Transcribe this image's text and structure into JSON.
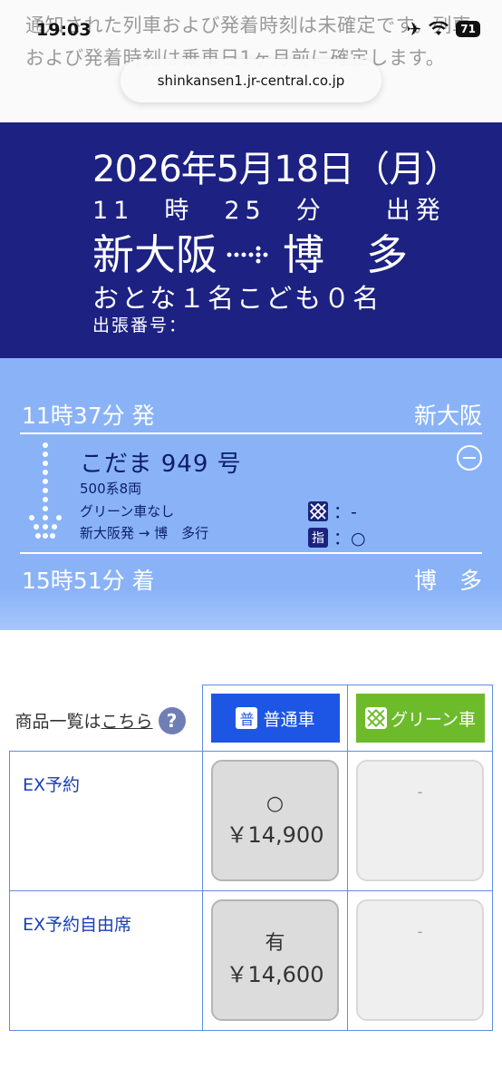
{
  "status": {
    "time": "19:03",
    "battery": "71"
  },
  "browser": {
    "url": "shinkansen1.jr-central.co.jp"
  },
  "notice": "通知された列車および発着時刻は未確定です。列車および発着時刻は乗車日1ヶ月前に確定します。",
  "header": {
    "date": "2026年5月18日（月）",
    "time": "11　時　25　分　　出発",
    "from": "新大阪",
    "to": "博　多",
    "passengers": "おとな１名こども０名",
    "business_no": "出張番号："
  },
  "train": {
    "depart_time": "11時37分 発",
    "depart_station": "新大阪",
    "name": "こだま 949 号",
    "cars": "500系8両",
    "green": "グリーン車なし",
    "direction": "新大阪発 → 博　多行",
    "green_seat_value": "：-",
    "reserved_icon": "指",
    "reserved_seat_value": "：○",
    "arrive_time": "15時51分 着",
    "arrive_station": "博　多"
  },
  "fare_table": {
    "list_prefix": "商品一覧は",
    "list_link": "こちら",
    "help": "?",
    "col_regular_badge": "普",
    "col_regular": "普通車",
    "col_green": "グリーン車",
    "rows": [
      {
        "label": "EX予約",
        "regular_mark": "○",
        "regular_price": "￥14,900",
        "green_mark": "-"
      },
      {
        "label": "EX予約自由席",
        "regular_mark": "有",
        "regular_price": "￥14,600",
        "green_mark": "-"
      }
    ]
  },
  "colors": {
    "header_bg": "#1c2182",
    "panel_bg": "#8ab3f7",
    "regular_tab": "#1d56e5",
    "green_tab": "#6dbb2a"
  }
}
